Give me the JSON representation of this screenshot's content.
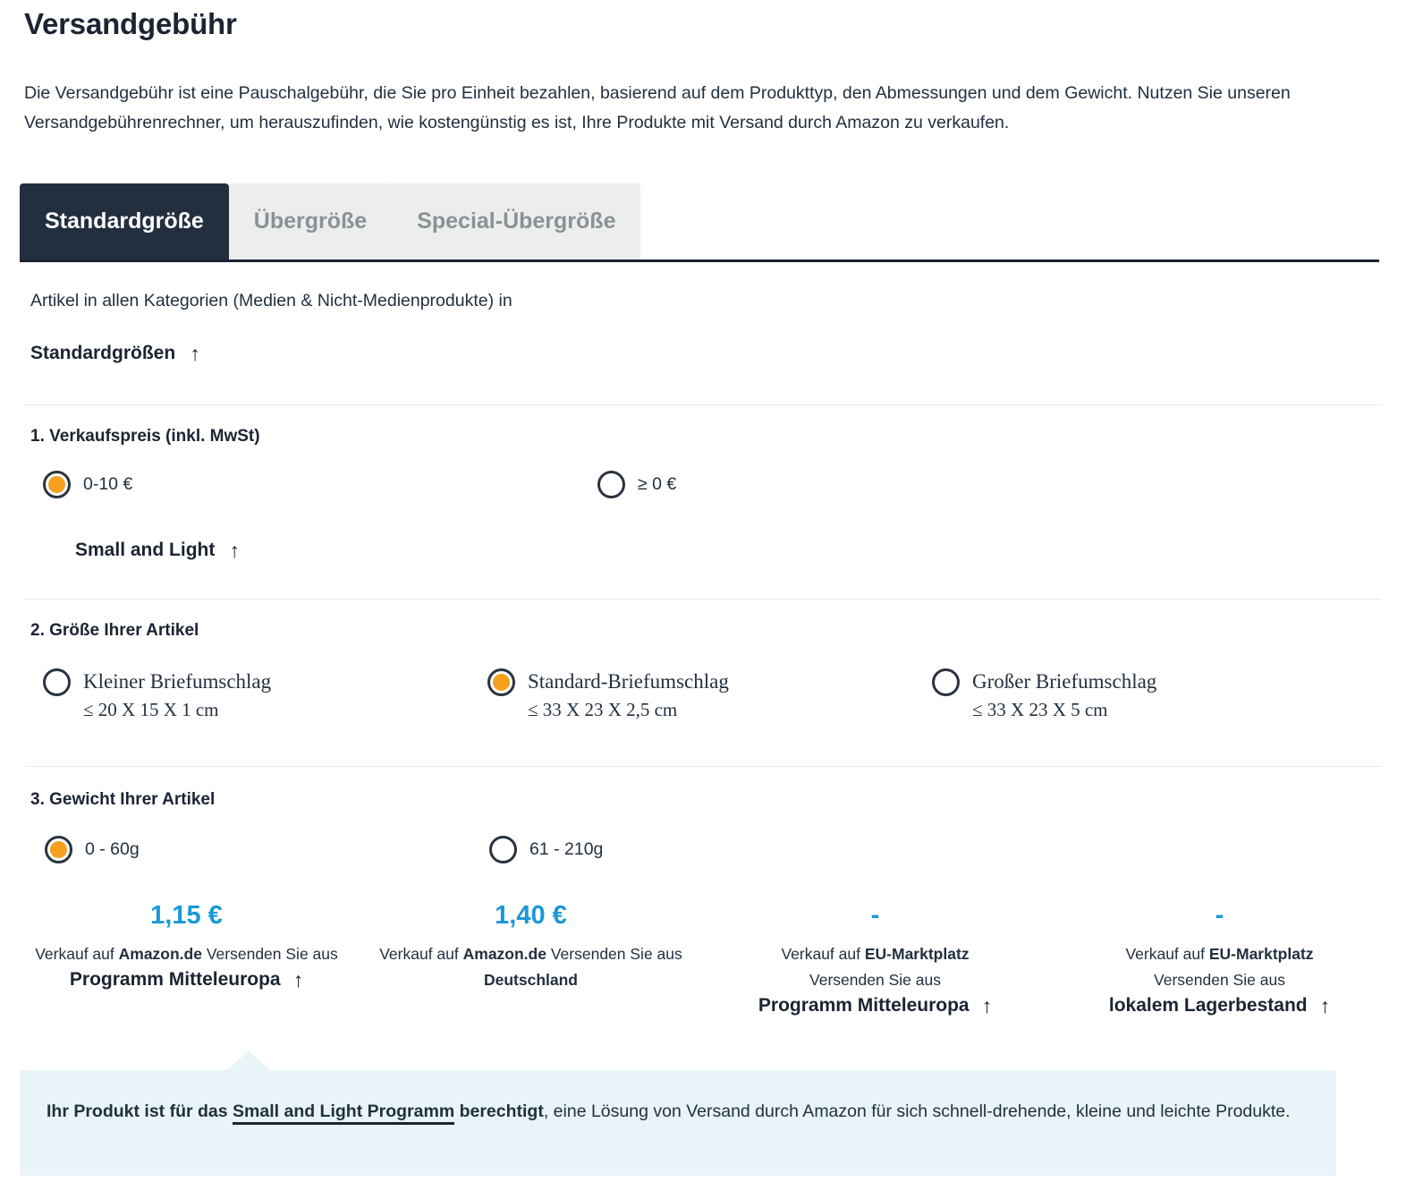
{
  "header": {
    "title": "Versandgebühr",
    "intro": "Die Versandgebühr ist eine Pauschalgebühr, die Sie pro Einheit bezahlen, basierend auf dem Produkttyp, den Abmessungen und dem Gewicht. Nutzen Sie unseren Versandgebührenrechner, um herauszufinden, wie kostengünstig es ist, Ihre Produkte mit Versand durch Amazon zu verkaufen."
  },
  "tabs": [
    {
      "label": "Standardgröße",
      "active": true
    },
    {
      "label": "Übergröße",
      "active": false
    },
    {
      "label": "Special-Übergröße",
      "active": false
    }
  ],
  "category": {
    "line": "Artikel in allen Kategorien (Medien & Nicht-Medienprodukte) in",
    "strong": "Standardgrößen",
    "arrow": "arrow-up-icon",
    "arrow_glyph": "↑"
  },
  "steps": [
    {
      "title": "1. Verkaufspreis (inkl. MwSt)",
      "options": [
        {
          "label": "0-10 €",
          "selected": true
        },
        {
          "label": "≥ 0 €",
          "selected": false
        }
      ],
      "sub_link": "Small and Light"
    },
    {
      "title": "2. Größe Ihrer Artikel",
      "options": [
        {
          "label": "Kleiner Briefumschlag",
          "dims": "≤ 20 X 15 X 1 cm",
          "selected": false
        },
        {
          "label": "Standard-Briefumschlag",
          "dims": "≤ 33 X 23 X 2,5 cm",
          "selected": true
        },
        {
          "label": "Großer Briefumschlag",
          "dims": "≤ 33 X 23 X 5 cm",
          "selected": false
        }
      ]
    },
    {
      "title": "3. Gewicht Ihrer Artikel",
      "options": [
        {
          "label": "0 - 60g",
          "selected": true
        },
        {
          "label": "61 - 210g",
          "selected": false
        }
      ]
    }
  ],
  "results": [
    {
      "price": "1,15 €",
      "desc_pre": "Verkauf auf ",
      "desc_bold": "Amazon.de",
      "desc_post": " Versenden Sie aus",
      "link": "Programm Mitteleuropa",
      "has_link": true
    },
    {
      "price": "1,40 €",
      "desc_pre": "Verkauf auf ",
      "desc_bold": "Amazon.de",
      "desc_post": " Versenden Sie aus ",
      "desc_bold2": "Deutschland",
      "has_link": false
    },
    {
      "price": "-",
      "desc_pre": "Verkauf auf ",
      "desc_bold": "EU-Marktplatz",
      "desc_post": " Versenden Sie aus",
      "link": "Programm Mitteleuropa",
      "has_link": true
    },
    {
      "price": "-",
      "desc_pre": "Verkauf auf ",
      "desc_bold": "EU-Marktplatz",
      "desc_post": " Versenden Sie aus",
      "link": "lokalem Lagerbestand",
      "has_link": true
    }
  ],
  "callout": {
    "pre": "Ihr Produkt ist für das ",
    "link": "Small and Light Programm",
    "mid": " berechtigt",
    "post": ", eine Lösung von Versand durch Amazon für sich schnell-drehende, kleine und leichte Produkte."
  },
  "colors": {
    "accent_orange": "#f5a01e",
    "dark_navy": "#232f3e",
    "price_blue": "#1a98d8",
    "callout_bg": "#e9f4f8",
    "tab_inactive_bg": "#eceded",
    "tab_inactive_text": "#8b9197"
  }
}
